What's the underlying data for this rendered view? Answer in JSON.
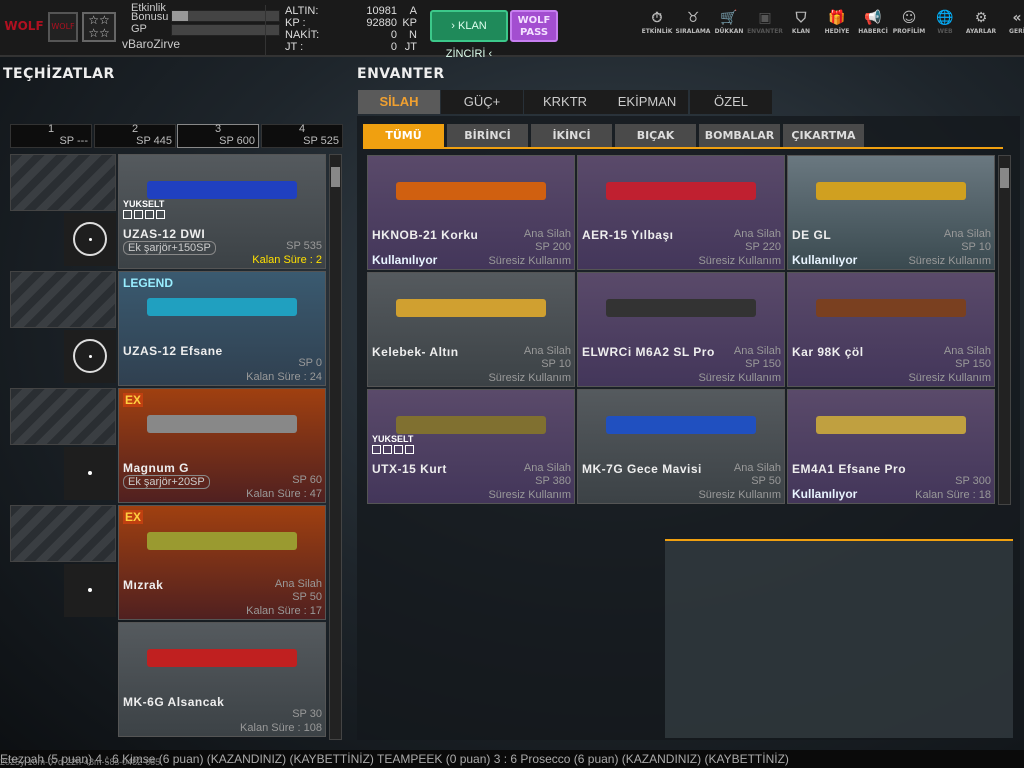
{
  "header": {
    "logo": "WOLF DİRİLİŞ",
    "event_bonus_label": "Etkinlik Bonusu",
    "event_bonus_progress": 0.15,
    "gp_label": "GP",
    "gp_progress": 0,
    "username": "vBaroZirve",
    "currencies": [
      {
        "label": "ALTIN:",
        "value": "10981",
        "unit": "A"
      },
      {
        "label": "KP :",
        "value": "92880",
        "unit": "KP"
      },
      {
        "label": "NAKİT:",
        "value": "0",
        "unit": "N"
      },
      {
        "label": "JT :",
        "value": "0",
        "unit": "JT"
      }
    ],
    "klan_button": "› KLAN ZİNCİRİ ‹",
    "wolf_pass": "WOLF PASS",
    "nav": [
      {
        "label": "ETKİNLİK",
        "icon": "⏱"
      },
      {
        "label": "SIRALAMA",
        "icon": "♉"
      },
      {
        "label": "DÜKKAN",
        "icon": "🛒"
      },
      {
        "label": "ENVANTER",
        "icon": "▣"
      },
      {
        "label": "KLAN",
        "icon": "⛉"
      },
      {
        "label": "HEDİYE",
        "icon": "🎁"
      },
      {
        "label": "HABERCİ",
        "icon": "📢"
      },
      {
        "label": "PROFİLİM",
        "icon": "☺"
      },
      {
        "label": "WEB",
        "icon": "🌐"
      },
      {
        "label": "AYARLAR",
        "icon": "⚙"
      },
      {
        "label": "GERİ",
        "icon": "«"
      }
    ]
  },
  "equipment": {
    "title": "TEÇHİZATLAR",
    "slots": [
      {
        "n": "1",
        "sp": "SP ---"
      },
      {
        "n": "2",
        "sp": "SP 445"
      },
      {
        "n": "3",
        "sp": "SP 600"
      },
      {
        "n": "4",
        "sp": "SP 525"
      }
    ],
    "items": [
      {
        "name": "UZAS-12 DWI",
        "badge": "",
        "upgrade": "YUKSELT",
        "mag": "Ek şarjör+150SP",
        "type": "",
        "sp": "SP 535",
        "duration": "Kalan Süre : 2",
        "color": "#2040c0"
      },
      {
        "name": "UZAS-12 Efsane",
        "badge": "LEGEND",
        "upgrade": "",
        "mag": "",
        "type": "",
        "sp": "SP 0",
        "duration": "Kalan Süre : 24",
        "color": "#20a0c0"
      },
      {
        "name": "Magnum G",
        "badge": "EX",
        "upgrade": "",
        "mag": "Ek şarjör+20SP",
        "type": "",
        "sp": "SP 60",
        "duration": "Kalan Süre : 47",
        "color": "#888"
      },
      {
        "name": "Mızrak",
        "badge": "EX",
        "upgrade": "",
        "mag": "",
        "type": "Ana Silah",
        "sp": "SP 50",
        "duration": "Kalan Süre : 17",
        "color": "#9a9a30"
      },
      {
        "name": "MK-6G Alsancak",
        "badge": "",
        "upgrade": "",
        "mag": "",
        "type": "",
        "sp": "SP 30",
        "duration": "Kalan Süre : 108",
        "color": "#c02020"
      }
    ]
  },
  "inventory": {
    "title": "ENVANTER",
    "tabs": [
      "SİLAH",
      "GÜÇ+",
      "KRKTR",
      "EKİPMAN",
      "ÖZEL"
    ],
    "subtabs": [
      "TÜMÜ",
      "BİRİNCİ",
      "İKİNCİ",
      "BIÇAK",
      "BOMBALAR",
      "ÇIKARTMA"
    ],
    "items": [
      {
        "name": "HKNOB-21 Korku",
        "type": "Ana Silah",
        "sp": "SP 200",
        "duration": "Süresiz Kullanım",
        "status": "Kullanılıyor",
        "upgrade": "",
        "bg": "purple",
        "color": "#d06010"
      },
      {
        "name": "AER-15 Yılbaşı",
        "type": "Ana Silah",
        "sp": "SP 220",
        "duration": "Süresiz Kullanım",
        "status": "",
        "upgrade": "",
        "bg": "purple",
        "color": "#c02030"
      },
      {
        "name": "DE GL",
        "type": "Ana Silah",
        "sp": "SP 10",
        "duration": "Süresiz Kullanım",
        "status": "Kullanılıyor",
        "upgrade": "",
        "bg": "teal",
        "color": "#d0a020"
      },
      {
        "name": "Kelebek- Altın",
        "type": "Ana Silah",
        "sp": "SP 10",
        "duration": "Süresiz Kullanım",
        "status": "",
        "upgrade": "",
        "bg": "gray",
        "color": "#d0a030"
      },
      {
        "name": "ELWRCi M6A2 SL Pro",
        "type": "Ana Silah",
        "sp": "SP 150",
        "duration": "Süresiz Kullanım",
        "status": "",
        "upgrade": "",
        "bg": "purple",
        "color": "#333"
      },
      {
        "name": "Kar 98K çöl",
        "type": "Ana Silah",
        "sp": "SP 150",
        "duration": "Süresiz Kullanım",
        "status": "",
        "upgrade": "",
        "bg": "purple",
        "color": "#7a4020"
      },
      {
        "name": "UTX-15 Kurt",
        "type": "Ana Silah",
        "sp": "SP 380",
        "duration": "Süresiz Kullanım",
        "status": "",
        "upgrade": "YUKSELT",
        "bg": "purple",
        "color": "#807030"
      },
      {
        "name": "MK-7G Gece Mavisi",
        "type": "Ana Silah",
        "sp": "SP 50",
        "duration": "Süresiz Kullanım",
        "status": "",
        "upgrade": "",
        "bg": "gray",
        "color": "#2050c0"
      },
      {
        "name": "EM4A1 Efsane Pro",
        "type": "",
        "sp": "SP 300",
        "duration": "Kalan Süre : 18",
        "status": "Kullanılıyor",
        "upgrade": "",
        "bg": "purple",
        "color": "#c0a040"
      }
    ]
  },
  "ticker": {
    "text": "Etezpah (5 puan) 4 : 6 Kimse (6 puan) (KAZANDINIZ)        (KAYBETTİNİZ) TEAMPEEK (0 puan) 3 : 6 Prosecco (6 puan) (KAZANDINIZ)        (KAYBETTİNİZ)",
    "timestamp": "2025y-10m-07d-22h-48m-58s-0482-685"
  }
}
